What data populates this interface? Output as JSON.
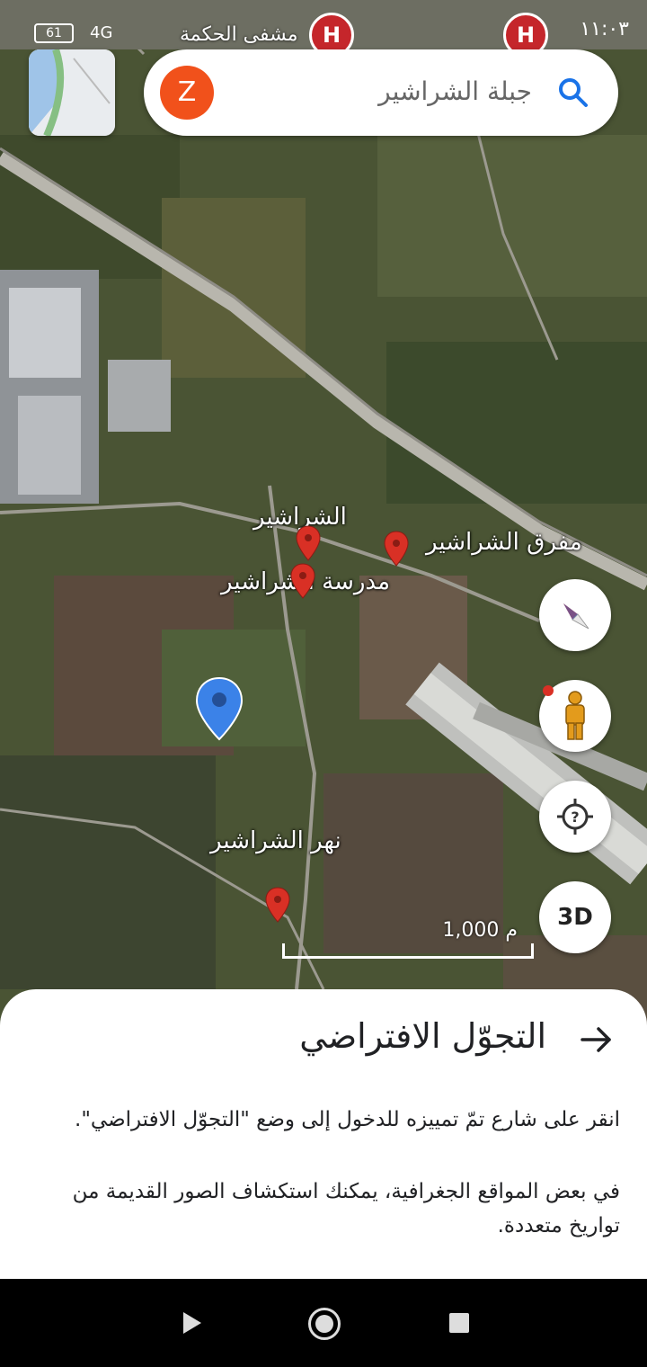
{
  "status_bar": {
    "time": "١١:٠٣",
    "battery": "61",
    "network": "4G"
  },
  "search": {
    "avatar_letter": "Z",
    "query": "جبلة الشراشير"
  },
  "map_labels": {
    "hospital_label": "مشفى الحكمة",
    "place_1": "الشراشير",
    "place_2": "مفرق الشراشير",
    "place_3": "مدرسة الشراشير",
    "place_4": "نهر الشراشير"
  },
  "hospital_marker": "H",
  "controls": {
    "three_d": "3D"
  },
  "scale": {
    "value": "1,000 م"
  },
  "sheet": {
    "title": "التجوّل الافتراضي",
    "paragraph_1": "انقر على شارع تمّ تمييزه للدخول إلى وضع \"التجوّل الافتراضي\".",
    "paragraph_2": "في بعض المواقع الجغرافية، يمكنك استكشاف الصور القديمة من تواريخ متعددة."
  },
  "colors": {
    "pin_red": "#d93025",
    "location_blue": "#3b82e8",
    "avatar": "#f1511b",
    "hospital": "#c5262b"
  }
}
